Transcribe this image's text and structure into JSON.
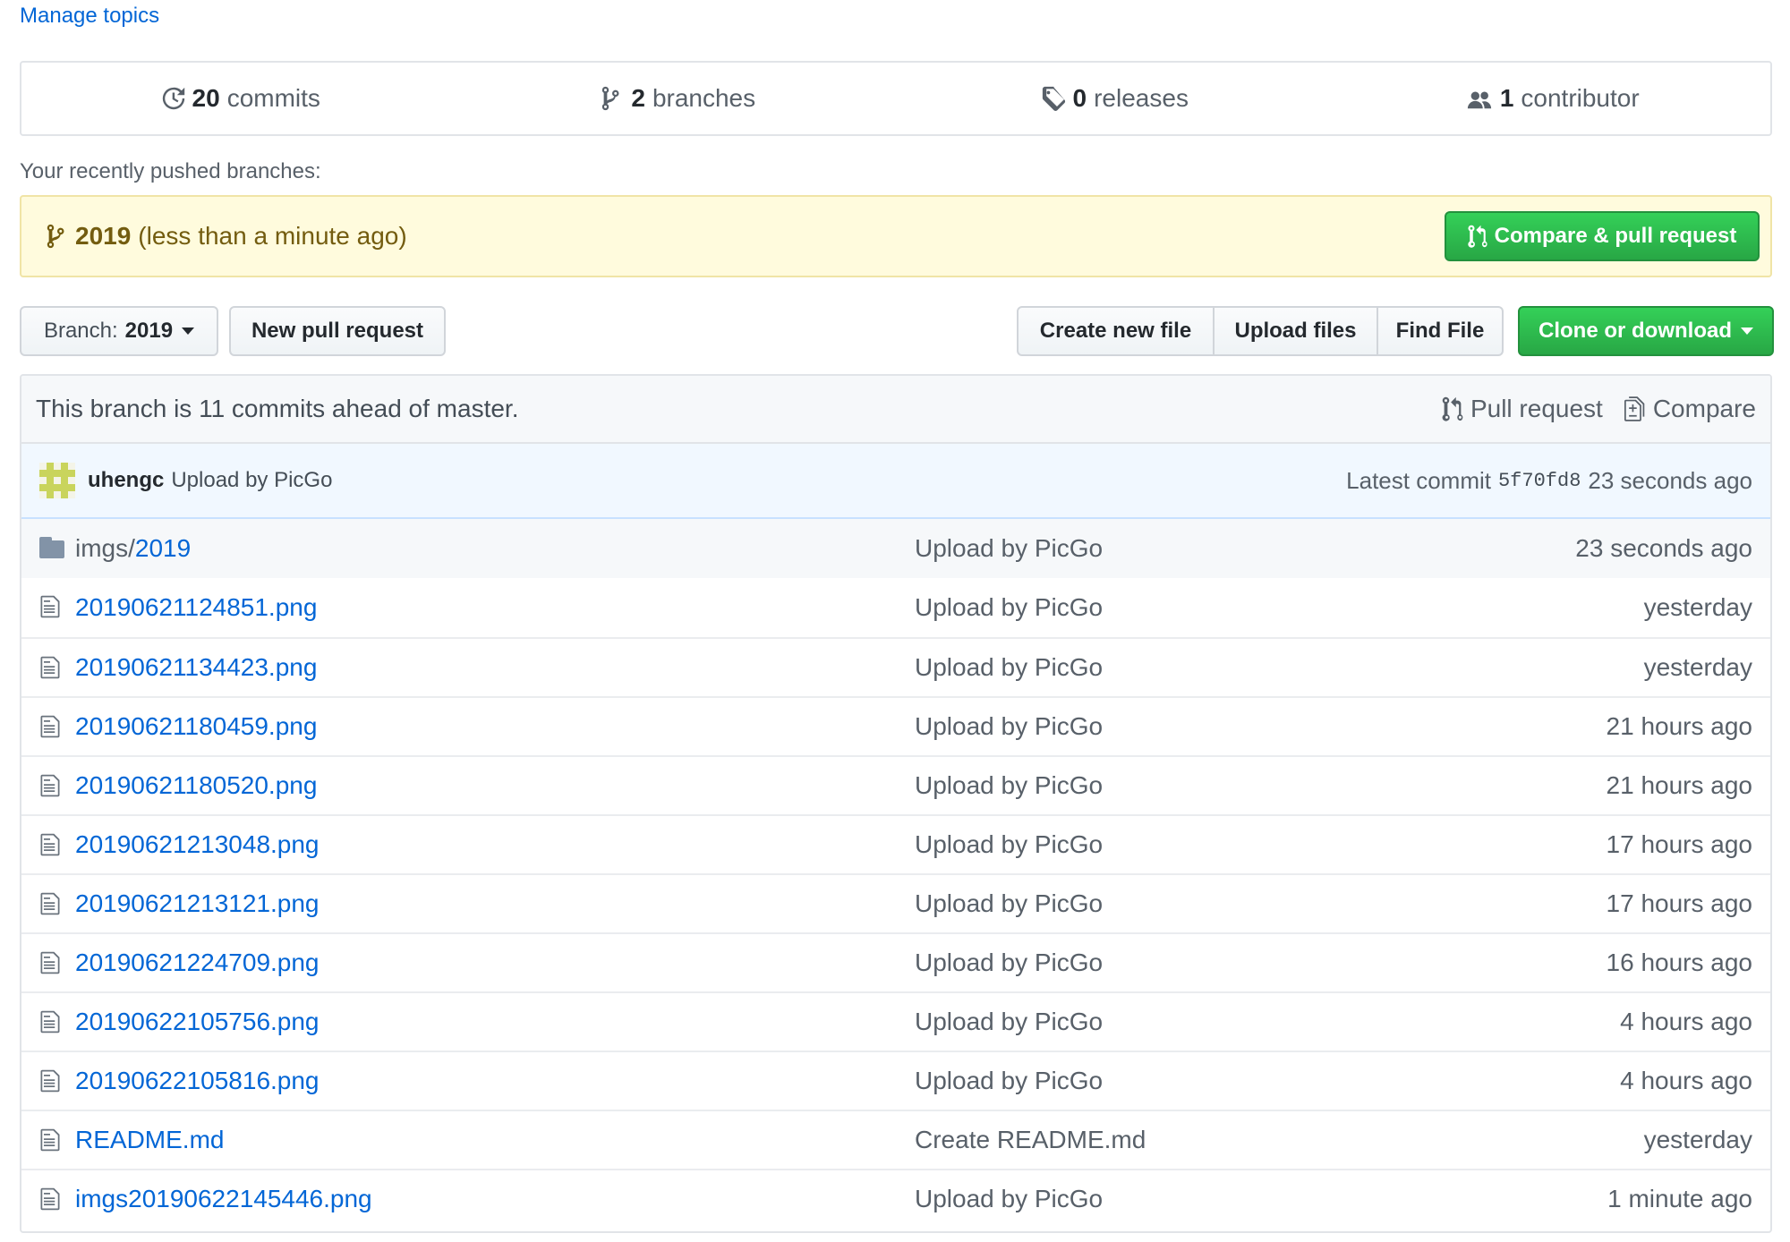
{
  "manage_topics": "Manage topics",
  "stats": {
    "commits": {
      "count": "20",
      "label": "commits",
      "icon": "history-icon"
    },
    "branches": {
      "count": "2",
      "label": "branches",
      "icon": "branch-icon"
    },
    "releases": {
      "count": "0",
      "label": "releases",
      "icon": "tag-icon"
    },
    "contributors": {
      "count": "1",
      "label": "contributor",
      "icon": "people-icon"
    }
  },
  "recent": {
    "label": "Your recently pushed branches:",
    "branch": "2019",
    "time": "(less than a minute ago)",
    "compare_button": "Compare & pull request"
  },
  "toolbar": {
    "branch_prefix": "Branch:",
    "branch_name": "2019",
    "new_pull_request": "New pull request",
    "create_new_file": "Create new file",
    "upload_files": "Upload files",
    "find_file": "Find File",
    "clone_or_download": "Clone or download"
  },
  "ahead": {
    "text": "This branch is 11 commits ahead of master.",
    "pull_request": "Pull request",
    "compare": "Compare"
  },
  "latest_commit": {
    "author": "uhengc",
    "message": "Upload by PicGo",
    "label": "Latest commit",
    "sha": "5f70fd8",
    "age": "23 seconds ago"
  },
  "colors": {
    "link": "#0366d6",
    "green": "#28a745",
    "warning_bg": "#fffbdd",
    "commit_bg": "#f1f8ff"
  },
  "up_row": {
    "prefix": "imgs/",
    "name": "2019",
    "message": "Upload by PicGo",
    "age": "23 seconds ago"
  },
  "files": [
    {
      "name": "20190621124851.png",
      "message": "Upload by PicGo",
      "age": "yesterday"
    },
    {
      "name": "20190621134423.png",
      "message": "Upload by PicGo",
      "age": "yesterday"
    },
    {
      "name": "20190621180459.png",
      "message": "Upload by PicGo",
      "age": "21 hours ago"
    },
    {
      "name": "20190621180520.png",
      "message": "Upload by PicGo",
      "age": "21 hours ago"
    },
    {
      "name": "20190621213048.png",
      "message": "Upload by PicGo",
      "age": "17 hours ago"
    },
    {
      "name": "20190621213121.png",
      "message": "Upload by PicGo",
      "age": "17 hours ago"
    },
    {
      "name": "20190621224709.png",
      "message": "Upload by PicGo",
      "age": "16 hours ago"
    },
    {
      "name": "20190622105756.png",
      "message": "Upload by PicGo",
      "age": "4 hours ago"
    },
    {
      "name": "20190622105816.png",
      "message": "Upload by PicGo",
      "age": "4 hours ago"
    },
    {
      "name": "README.md",
      "message": "Create README.md",
      "age": "yesterday"
    },
    {
      "name": "imgs20190622145446.png",
      "message": "Upload by PicGo",
      "age": "1 minute ago"
    }
  ]
}
